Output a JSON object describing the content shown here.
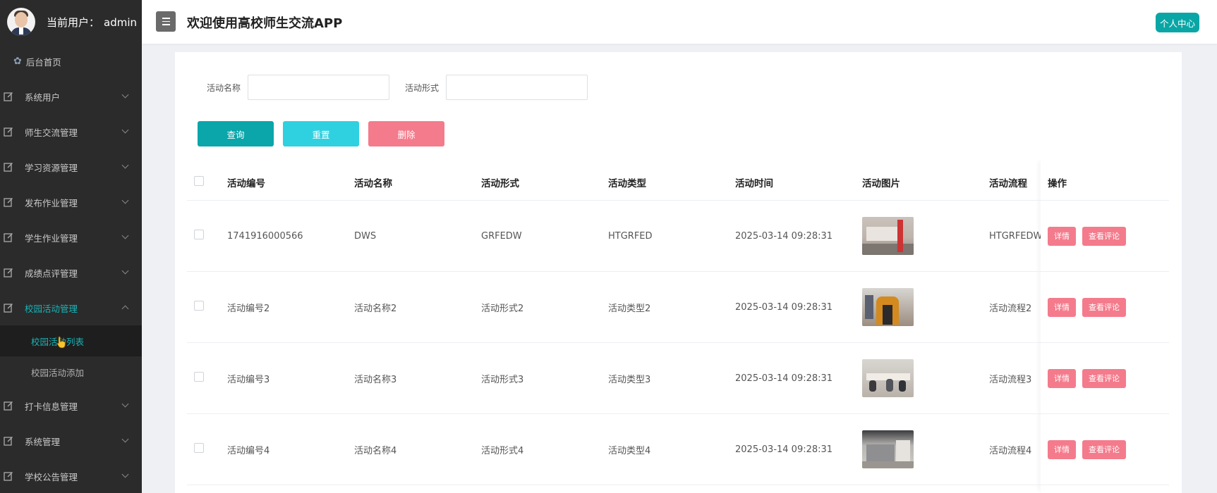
{
  "sidebar": {
    "user_prefix": "当前用户：",
    "user_name": "admin",
    "home": "后台首页",
    "menu": [
      {
        "label": "系统用户"
      },
      {
        "label": "师生交流管理"
      },
      {
        "label": "学习资源管理"
      },
      {
        "label": "发布作业管理"
      },
      {
        "label": "学生作业管理"
      },
      {
        "label": "成绩点评管理"
      },
      {
        "label": "校园活动管理"
      },
      {
        "label": "打卡信息管理"
      },
      {
        "label": "系统管理"
      },
      {
        "label": "学校公告管理"
      }
    ],
    "submenu": [
      {
        "label": "校园活动列表"
      },
      {
        "label": "校园活动添加"
      }
    ]
  },
  "header": {
    "title": "欢迎使用高校师生交流APP",
    "personal_center": "个人中心"
  },
  "search": {
    "name_label": "活动名称",
    "form_label": "活动形式",
    "query": "查询",
    "reset": "重置",
    "delete": "删除"
  },
  "table": {
    "columns": [
      "活动编号",
      "活动名称",
      "活动形式",
      "活动类型",
      "活动时间",
      "活动图片",
      "活动流程",
      "操作"
    ],
    "rows": [
      {
        "no": "1741916000566",
        "name": "DWS",
        "form": "GRFEDW",
        "type": "HTGRFED",
        "time": "2025-03-14 09:28:31",
        "flow": "HTGRFEDWS",
        "image": "activity-photo-1"
      },
      {
        "no": "活动编号2",
        "name": "活动名称2",
        "form": "活动形式2",
        "type": "活动类型2",
        "time": "2025-03-14 09:28:31",
        "flow": "活动流程2",
        "image": "activity-photo-2"
      },
      {
        "no": "活动编号3",
        "name": "活动名称3",
        "form": "活动形式3",
        "type": "活动类型3",
        "time": "2025-03-14 09:28:31",
        "flow": "活动流程3",
        "image": "activity-photo-3"
      },
      {
        "no": "活动编号4",
        "name": "活动名称4",
        "form": "活动形式4",
        "type": "活动类型4",
        "time": "2025-03-14 09:28:31",
        "flow": "活动流程4",
        "image": "activity-photo-4"
      }
    ],
    "detail_label": "详情",
    "comment_label": "查看评论"
  },
  "colors": {
    "sidebar_bg": "#2b2b2b",
    "accent": "#0aa6aa",
    "reset_btn": "#2fd0e0",
    "danger": "#f47b8c"
  }
}
